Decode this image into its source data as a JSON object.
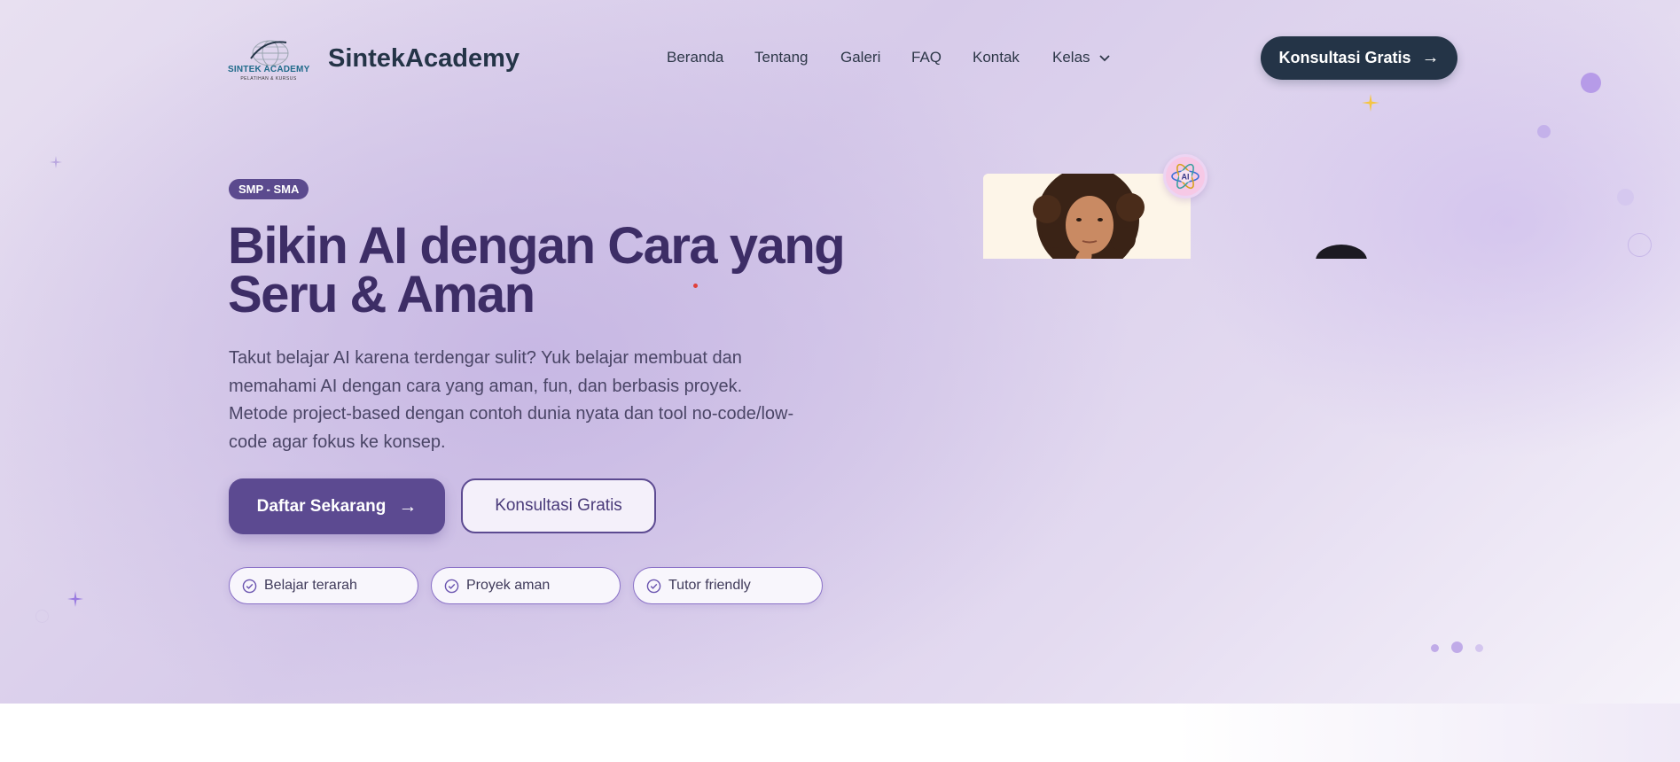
{
  "header": {
    "logo_text": "SINTEK ACADEMY",
    "logo_subtext": "PELATIHAN & KURSUS",
    "brand": "SintekAcademy",
    "nav": [
      "Beranda",
      "Tentang",
      "Galeri",
      "FAQ",
      "Kontak",
      "Kelas"
    ],
    "cta_label": "Konsultasi Gratis",
    "cta_arrow": "→"
  },
  "hero": {
    "badge": "SMP - SMA",
    "title_line1": "Bikin AI dengan Cara yang",
    "title_line2": "Seru & Aman",
    "description": "Takut belajar AI karena terdengar sulit? Yuk belajar membuat dan memahami AI dengan cara yang aman, fun, dan berbasis proyek. Metode project-based dengan contoh dunia nyata dan tool no-code/low-code agar fokus ke konsep.",
    "primary_button": "Daftar Sekarang",
    "primary_arrow": "→",
    "secondary_button": "Konsultasi Gratis",
    "features": [
      "Belajar terarah",
      "Proyek aman",
      "Tutor friendly"
    ],
    "ai_badge": "AI"
  },
  "colors": {
    "navy": "#243447",
    "purple": "#5c4a91",
    "title": "#3d2d66",
    "accent_star": "#f5c542"
  },
  "icons": [
    "chevron-down-icon",
    "arrow-right-icon",
    "check-circle-icon",
    "sparkle-icon",
    "ai-atom-icon"
  ]
}
